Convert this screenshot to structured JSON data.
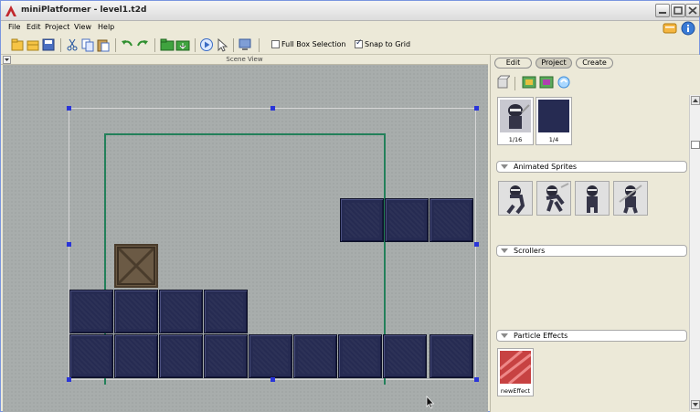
{
  "window": {
    "title": "miniPlatformer - level1.t2d"
  },
  "menu": [
    "File",
    "Edit",
    "Project",
    "View",
    "Help"
  ],
  "toolbar": {
    "full_box_selection_label": "Full Box Selection",
    "full_box_selection_checked": false,
    "snap_to_grid_label": "Snap to Grid",
    "snap_to_grid_checked": true
  },
  "scene": {
    "title": "Scene View"
  },
  "panel": {
    "tabs": [
      "Edit",
      "Project",
      "Create"
    ],
    "active_tab": "Project",
    "static_sprites": [
      {
        "caption": "1/16"
      },
      {
        "caption": "1/4"
      }
    ],
    "sections": {
      "animated_sprites": "Animated Sprites",
      "scrollers": "Scrollers",
      "particle_effects": "Particle Effects"
    },
    "particle_effects": [
      {
        "caption": "newEffect"
      }
    ]
  },
  "colors": {
    "tile": "#262b52",
    "camera_box": "#23805a",
    "selection_handle": "#2a35d8",
    "canvas": "#a8adac"
  }
}
